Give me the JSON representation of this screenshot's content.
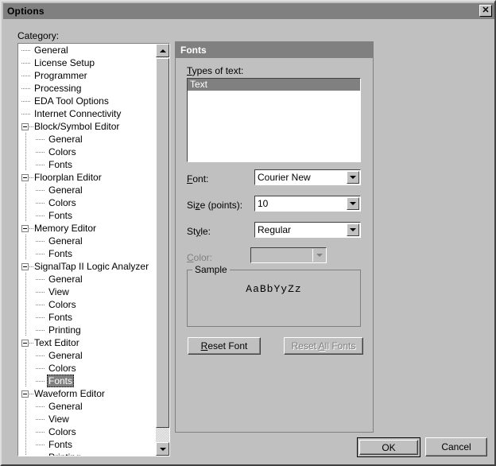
{
  "window": {
    "title": "Options",
    "close_icon": "close-icon",
    "close_glyph": "✕"
  },
  "colors": {
    "face": "#c0c0c0",
    "titlebar": "#808080",
    "highlight": "#808080",
    "highlight_text": "#ffffff",
    "panel_header": "#808080",
    "disabled_text": "#808080",
    "window_bg": "#ffffff"
  },
  "category": {
    "label": "Category:",
    "items": [
      {
        "label": "General",
        "level": 0,
        "expandable": false,
        "selected": false
      },
      {
        "label": "License Setup",
        "level": 0,
        "expandable": false,
        "selected": false
      },
      {
        "label": "Programmer",
        "level": 0,
        "expandable": false,
        "selected": false
      },
      {
        "label": "Processing",
        "level": 0,
        "expandable": false,
        "selected": false
      },
      {
        "label": "EDA Tool Options",
        "level": 0,
        "expandable": false,
        "selected": false
      },
      {
        "label": "Internet Connectivity",
        "level": 0,
        "expandable": false,
        "selected": false
      },
      {
        "label": "Block/Symbol Editor",
        "level": 0,
        "expandable": true,
        "selected": false
      },
      {
        "label": "General",
        "level": 1,
        "expandable": false,
        "selected": false
      },
      {
        "label": "Colors",
        "level": 1,
        "expandable": false,
        "selected": false
      },
      {
        "label": "Fonts",
        "level": 1,
        "expandable": false,
        "selected": false
      },
      {
        "label": "Floorplan Editor",
        "level": 0,
        "expandable": true,
        "selected": false
      },
      {
        "label": "General",
        "level": 1,
        "expandable": false,
        "selected": false
      },
      {
        "label": "Colors",
        "level": 1,
        "expandable": false,
        "selected": false
      },
      {
        "label": "Fonts",
        "level": 1,
        "expandable": false,
        "selected": false
      },
      {
        "label": "Memory Editor",
        "level": 0,
        "expandable": true,
        "selected": false
      },
      {
        "label": "General",
        "level": 1,
        "expandable": false,
        "selected": false
      },
      {
        "label": "Fonts",
        "level": 1,
        "expandable": false,
        "selected": false
      },
      {
        "label": "SignalTap II Logic Analyzer",
        "level": 0,
        "expandable": true,
        "selected": false
      },
      {
        "label": "General",
        "level": 1,
        "expandable": false,
        "selected": false
      },
      {
        "label": "View",
        "level": 1,
        "expandable": false,
        "selected": false
      },
      {
        "label": "Colors",
        "level": 1,
        "expandable": false,
        "selected": false
      },
      {
        "label": "Fonts",
        "level": 1,
        "expandable": false,
        "selected": false
      },
      {
        "label": "Printing",
        "level": 1,
        "expandable": false,
        "selected": false
      },
      {
        "label": "Text Editor",
        "level": 0,
        "expandable": true,
        "selected": false
      },
      {
        "label": "General",
        "level": 1,
        "expandable": false,
        "selected": false
      },
      {
        "label": "Colors",
        "level": 1,
        "expandable": false,
        "selected": false
      },
      {
        "label": "Fonts",
        "level": 1,
        "expandable": false,
        "selected": true
      },
      {
        "label": "Waveform Editor",
        "level": 0,
        "expandable": true,
        "selected": false
      },
      {
        "label": "General",
        "level": 1,
        "expandable": false,
        "selected": false
      },
      {
        "label": "View",
        "level": 1,
        "expandable": false,
        "selected": false
      },
      {
        "label": "Colors",
        "level": 1,
        "expandable": false,
        "selected": false
      },
      {
        "label": "Fonts",
        "level": 1,
        "expandable": false,
        "selected": false
      },
      {
        "label": "Printing",
        "level": 1,
        "expandable": false,
        "selected": false
      }
    ],
    "scrollbar": {
      "up_icon": "scroll-up-arrow-icon",
      "down_icon": "scroll-down-arrow-icon"
    }
  },
  "panel": {
    "header": "Fonts",
    "types_of_text": {
      "label_prefix": "T",
      "label_rest": "ypes of text:",
      "items": [
        {
          "label": "Text",
          "selected": true
        }
      ]
    },
    "font": {
      "label_prefix": "F",
      "label_rest": "ont:",
      "value": "Courier New",
      "arrow_icon": "chevron-down-icon"
    },
    "size": {
      "label_pre": "Si",
      "label_accel": "z",
      "label_post": "e (points):",
      "value": "10",
      "arrow_icon": "chevron-down-icon"
    },
    "style": {
      "label_pre": "St",
      "label_accel": "y",
      "label_post": "le:",
      "value": "Regular",
      "arrow_icon": "chevron-down-icon"
    },
    "color": {
      "label_prefix": "C",
      "label_rest": "olor:",
      "value": "",
      "enabled": false,
      "arrow_icon": "chevron-down-icon"
    },
    "sample": {
      "legend": "Sample",
      "text": "AaBbYyZz"
    },
    "reset_font": {
      "accel": "R",
      "rest": "eset Font",
      "enabled": true
    },
    "reset_all_fonts": {
      "pre": "Reset ",
      "accel": "A",
      "post": "ll Fonts",
      "enabled": false
    }
  },
  "footer": {
    "ok": "OK",
    "cancel": "Cancel"
  }
}
